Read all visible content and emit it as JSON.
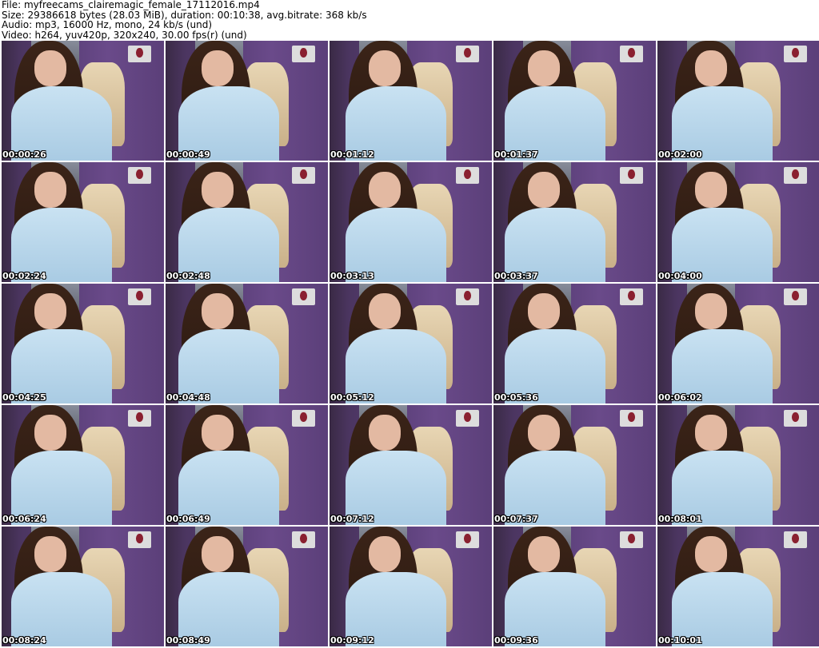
{
  "header": {
    "file": "File: myfreecams_clairemagic_female_17112016.mp4",
    "size": "Size: 29386618 bytes (28.03 MiB), duration: 00:10:38, avg.bitrate: 368 kb/s",
    "audio": "Audio: mp3, 16000 Hz, mono, 24 kb/s (und)",
    "video": "Video: h264, yuv420p, 320x240, 30.00 fps(r) (und)"
  },
  "thumbnails": [
    "00:00:26",
    "00:00:49",
    "00:01:12",
    "00:01:37",
    "00:02:00",
    "00:02:24",
    "00:02:48",
    "00:03:13",
    "00:03:37",
    "00:04:00",
    "00:04:25",
    "00:04:48",
    "00:05:12",
    "00:05:36",
    "00:06:02",
    "00:06:24",
    "00:06:49",
    "00:07:12",
    "00:07:37",
    "00:08:01",
    "00:08:24",
    "00:08:49",
    "00:09:12",
    "00:09:36",
    "00:10:01"
  ]
}
